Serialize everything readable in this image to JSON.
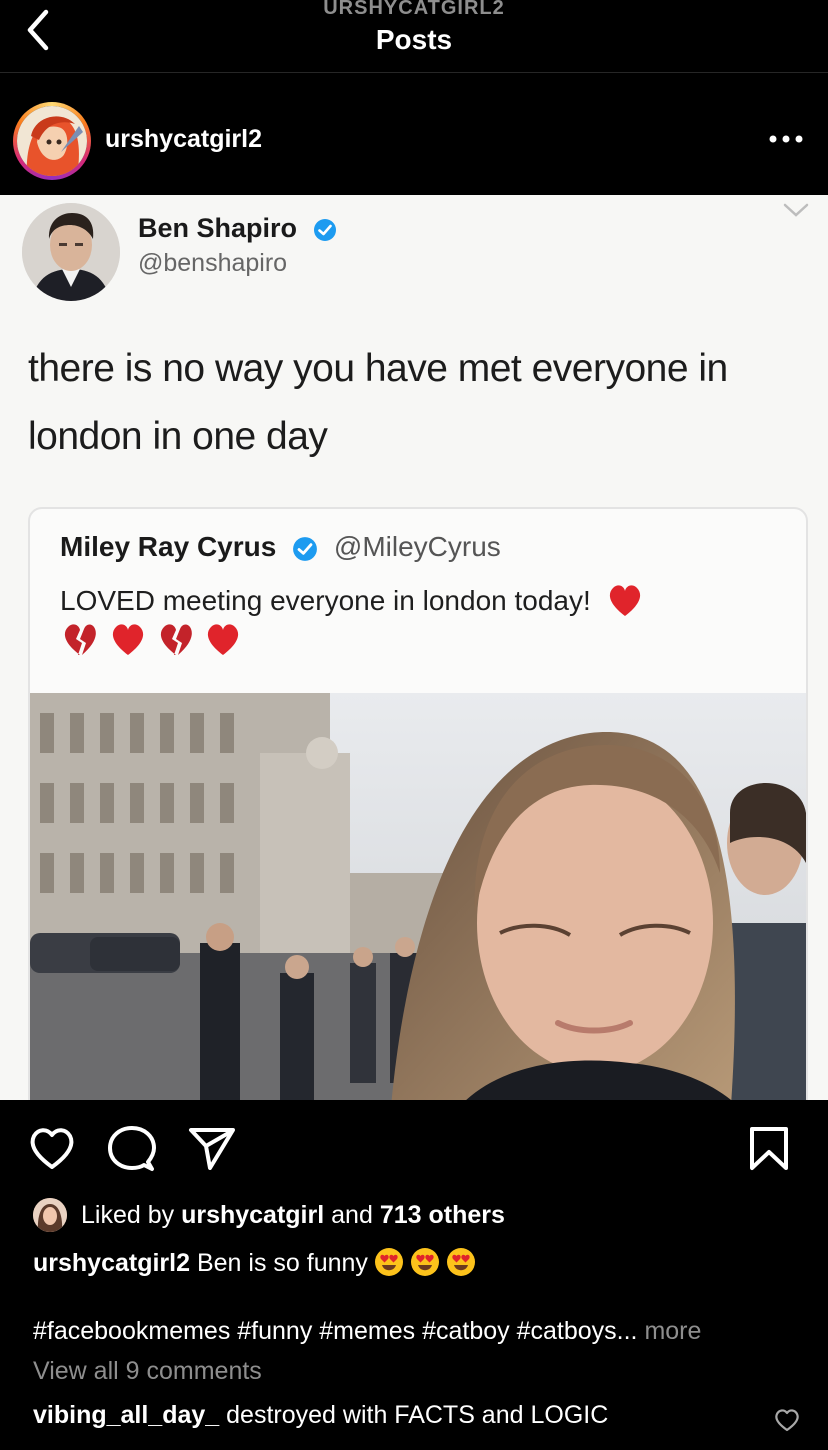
{
  "nav": {
    "account_label": "URSHYCATGIRL2",
    "title": "Posts"
  },
  "post": {
    "username": "urshycatgirl2",
    "media": {
      "tweet": {
        "name": "Ben Shapiro",
        "handle": "@benshapiro",
        "text": "there is no way you have met everyone in london in one day",
        "quoted": {
          "name": "Miley Ray Cyrus",
          "handle": "@MileyCyrus",
          "text": "LOVED meeting everyone in london today!"
        }
      }
    },
    "likes": {
      "prefix": "Liked by",
      "by_user": "urshycatgirl",
      "and": "and",
      "others": "713 others"
    },
    "caption": {
      "username": "urshycatgirl2",
      "text": "Ben is so funny"
    },
    "hashtags": "#facebookmemes #funny #memes #catboy #catboys...",
    "more_label": "more",
    "view_comments": "View all 9 comments",
    "top_comment": {
      "username": "vibing_all_day_",
      "text": "destroyed with FACTS and LOGIC"
    }
  },
  "icons": {
    "back": "chevron-left-icon",
    "more": "ellipsis-icon",
    "like": "heart-icon",
    "comment": "speech-bubble-icon",
    "share": "paper-plane-icon",
    "save": "bookmark-icon",
    "verified": "verified-badge-icon"
  },
  "colors": {
    "background": "#000000",
    "text": "#ffffff",
    "muted": "#8e8e8e",
    "verified": "#1d9bf0"
  }
}
